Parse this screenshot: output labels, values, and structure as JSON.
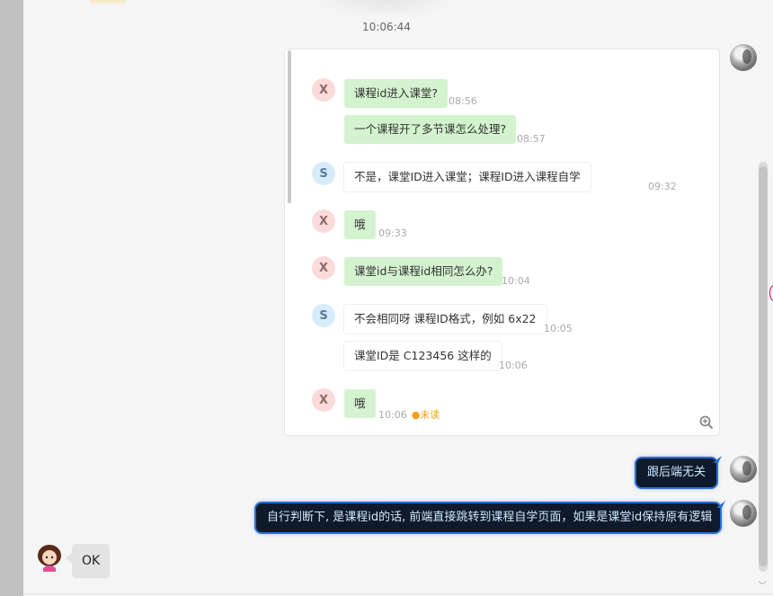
{
  "header": {
    "timestamp": "10:06:44"
  },
  "record": {
    "messages": [
      {
        "sender": "X",
        "text": "课程id进入课堂?",
        "time": "08:56",
        "style": "green"
      },
      {
        "sender": "",
        "text": "一个课程开了多节课怎么处理?",
        "time": "08:57",
        "style": "green"
      },
      {
        "sender": "S",
        "text": "不是，课堂ID进入课堂；课程ID进入课程自学",
        "time": "09:32",
        "style": "white"
      },
      {
        "sender": "X",
        "text": "哦",
        "time": "09:33",
        "style": "green"
      },
      {
        "sender": "X",
        "text": "课堂id与课程id相同怎么办?",
        "time": "10:04",
        "style": "green"
      },
      {
        "sender": "S",
        "text": "不会相同呀 课程ID格式，例如  6x22",
        "time": "10:05",
        "style": "white"
      },
      {
        "sender": "",
        "text": "课堂ID是  C123456 这样的",
        "time": "10:06",
        "style": "white"
      },
      {
        "sender": "X",
        "text": "哦",
        "time": "10:06",
        "style": "green"
      }
    ],
    "unread_label": "●未读"
  },
  "sent": {
    "msg1": "跟后端无关",
    "msg2": "自行判断下, 是课程id的话, 前端直接跳转到课程自学页面，如果是课堂id保持原有逻辑"
  },
  "received": {
    "msg": "OK"
  },
  "icons": {
    "zoom": "zoom-in-icon",
    "scroll": "chevron-down-icon"
  },
  "colors": {
    "accent": "#2a6fd6",
    "green_bubble": "#d3f3cf",
    "dark_bubble": "#0f1a2a"
  }
}
